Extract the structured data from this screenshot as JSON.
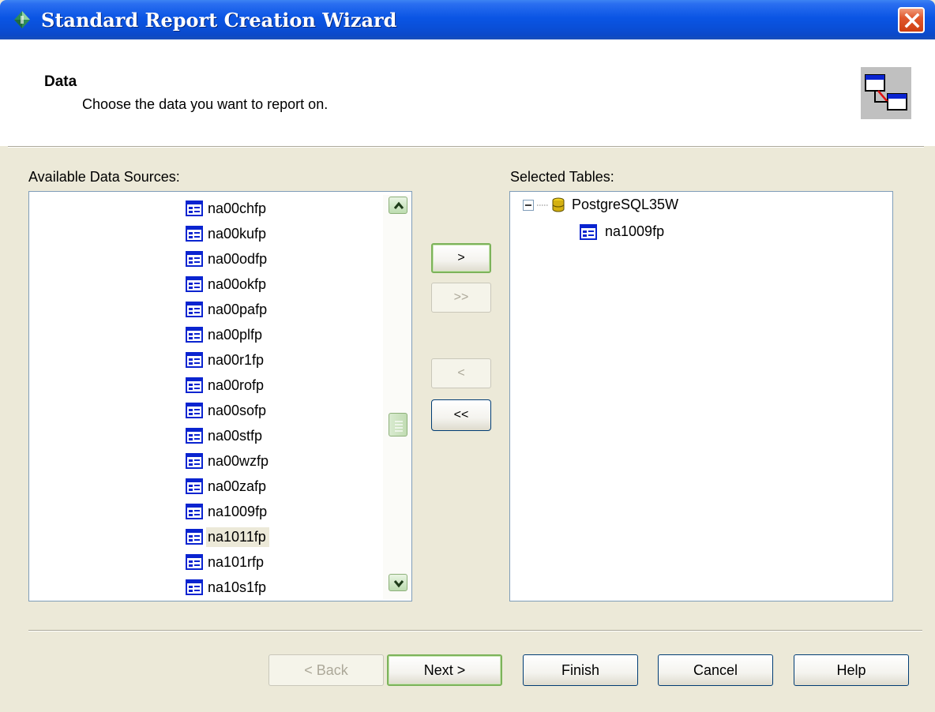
{
  "window": {
    "title": "Standard Report Creation Wizard"
  },
  "header": {
    "heading": "Data",
    "subheading": "Choose the data you want to report on."
  },
  "available": {
    "label": "Available Data Sources:",
    "items": [
      {
        "label": "na00chfp"
      },
      {
        "label": "na00kufp"
      },
      {
        "label": "na00odfp"
      },
      {
        "label": "na00okfp"
      },
      {
        "label": "na00pafp"
      },
      {
        "label": "na00plfp"
      },
      {
        "label": "na00r1fp"
      },
      {
        "label": "na00rofp"
      },
      {
        "label": "na00sofp"
      },
      {
        "label": "na00stfp"
      },
      {
        "label": "na00wzfp"
      },
      {
        "label": "na00zafp"
      },
      {
        "label": "na1009fp"
      },
      {
        "label": "na1011fp",
        "selected": true
      },
      {
        "label": "na101rfp"
      },
      {
        "label": "na10s1fp"
      }
    ]
  },
  "selected": {
    "label": "Selected Tables:",
    "root": "PostgreSQL35W",
    "children": [
      "na1009fp"
    ]
  },
  "move_buttons": {
    "add": ">",
    "add_all": ">>",
    "remove": "<",
    "remove_all": "<<"
  },
  "footer": {
    "back": "< Back",
    "next": "Next >",
    "finish": "Finish",
    "cancel": "Cancel",
    "help": "Help"
  },
  "colors": {
    "titlebar": "#0a55e4",
    "dialog_bg": "#ece9d8",
    "close_button": "#e0582d",
    "focus_green": "#7cb35a"
  }
}
